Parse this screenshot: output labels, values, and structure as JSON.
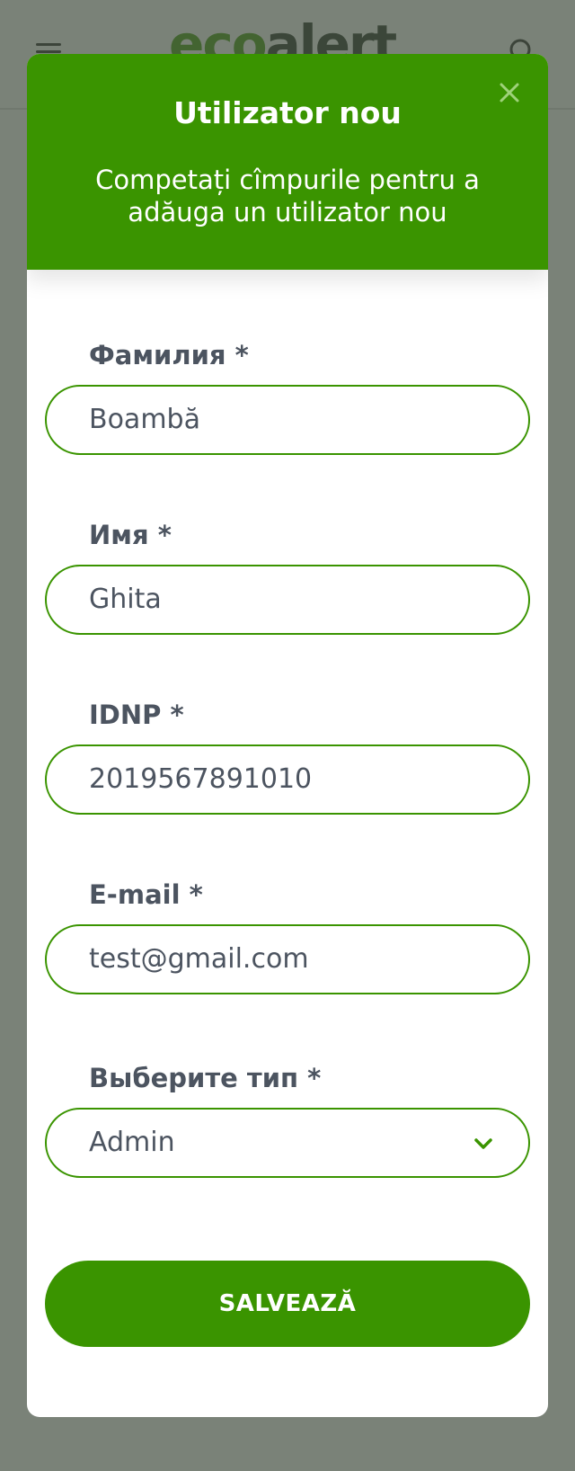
{
  "app": {
    "logo_text_green": "eco",
    "logo_text_dark": "alert"
  },
  "modal": {
    "title": "Utilizator nou",
    "subtitle": "Competați cîmpurile pentru a adăuga un utilizator nou"
  },
  "form": {
    "last_name": {
      "label": "Фамилия *",
      "value": "Boambă"
    },
    "first_name": {
      "label": "Имя *",
      "value": "Ghita"
    },
    "idnp": {
      "label": "IDNP *",
      "value": "2019567891010"
    },
    "email": {
      "label": "E-mail *",
      "value": "test@gmail.com"
    },
    "type": {
      "label": "Выберите тип *",
      "value": "Admin"
    }
  },
  "actions": {
    "save_label": "SALVEAZĂ"
  },
  "colors": {
    "accent": "#3a9400",
    "text": "#4c5460",
    "overlay": "#465244"
  }
}
